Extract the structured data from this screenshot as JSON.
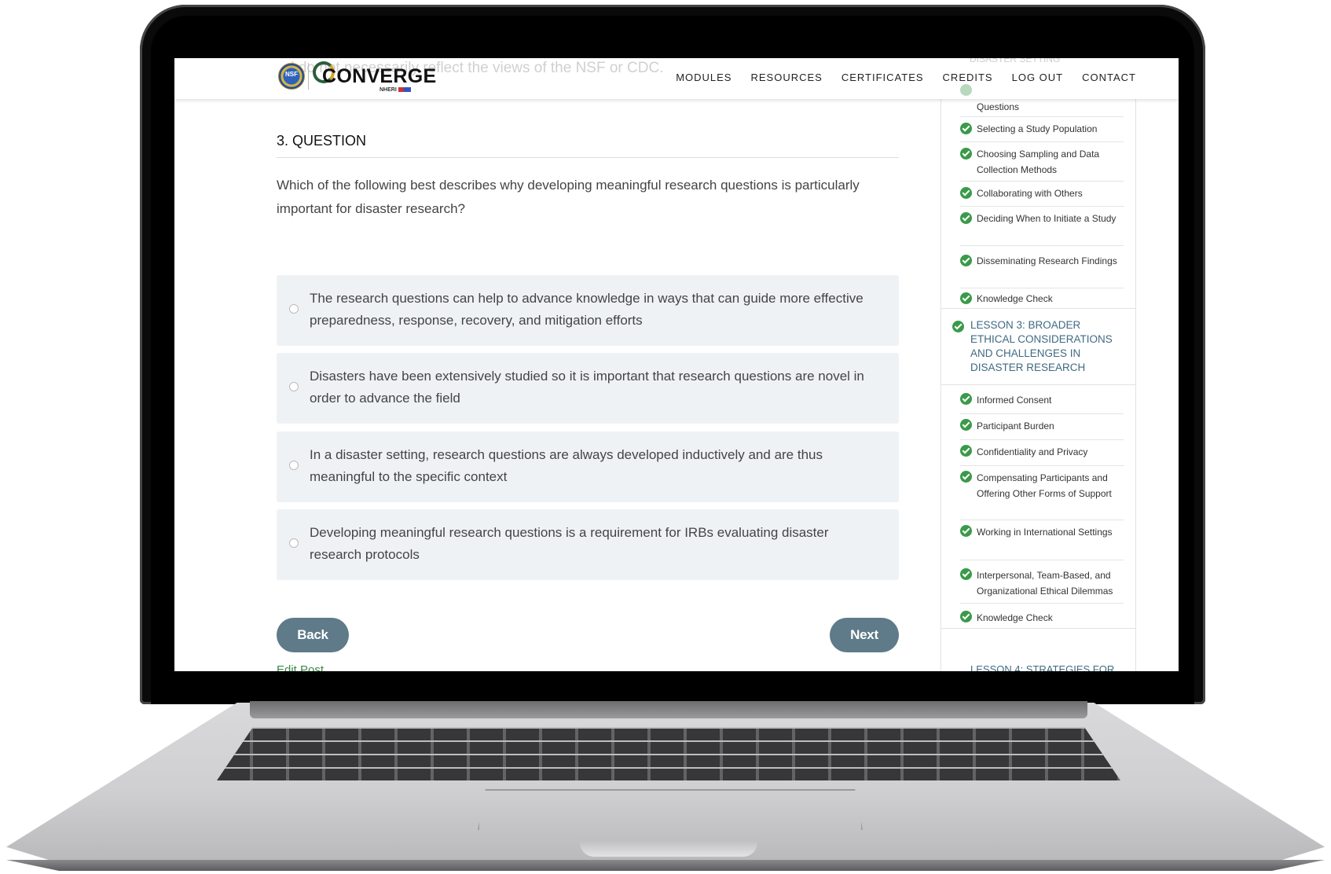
{
  "header": {
    "logo_seal_text": "NSF",
    "logo_word": "CONVERGE",
    "logo_sub": "NHERI",
    "ghost_text": "d do not necessarily reflect the views of the NSF or CDC.",
    "nav": [
      "MODULES",
      "RESOURCES",
      "CERTIFICATES",
      "CREDITS",
      "LOG OUT",
      "CONTACT"
    ]
  },
  "question": {
    "title": "3. QUESTION",
    "text": "Which of the following best describes why developing meaningful research questions is particularly important for disaster research?",
    "options": [
      "The research questions can help to advance knowledge in ways that can guide more effective preparedness, response, recovery, and mitigation efforts",
      "Disasters have been extensively studied so it is important that research questions are novel in order to advance the field",
      "In a disaster setting, research questions are always developed inductively and are thus meaningful to the specific context",
      "Developing meaningful research questions is a requirement for IRBs evaluating disaster research protocols"
    ]
  },
  "buttons": {
    "back": "Back",
    "next": "Next",
    "edit_post": "Edit Post"
  },
  "sidebar": {
    "ghost_top": "DISASTER SETTING",
    "items_a": [
      "Developing Meaningful Research Questions",
      "Selecting a Study Population",
      "Choosing Sampling and Data Collection Methods",
      "Collaborating with Others",
      "Deciding When to Initiate a Study",
      "Disseminating Research Findings",
      "Knowledge Check"
    ],
    "lesson3": "LESSON 3: BROADER ETHICAL CONSIDERATIONS AND CHALLENGES IN DISASTER RESEARCH",
    "items_b": [
      "Informed Consent",
      "Participant Burden",
      "Confidentiality and Privacy",
      "Compensating Participants and Offering Other Forms of Support",
      "Working in International Settings",
      "Interpersonal, Team-Based, and Organizational Ethical Dilemmas",
      "Knowledge Check"
    ],
    "lesson4_partial": "LESSON 4: STRATEGIES FOR"
  },
  "colors": {
    "accent_button": "#5f7a88",
    "check_green": "#3a9a4a",
    "lesson_link": "#3f6a82",
    "option_bg": "#eff2f5"
  }
}
